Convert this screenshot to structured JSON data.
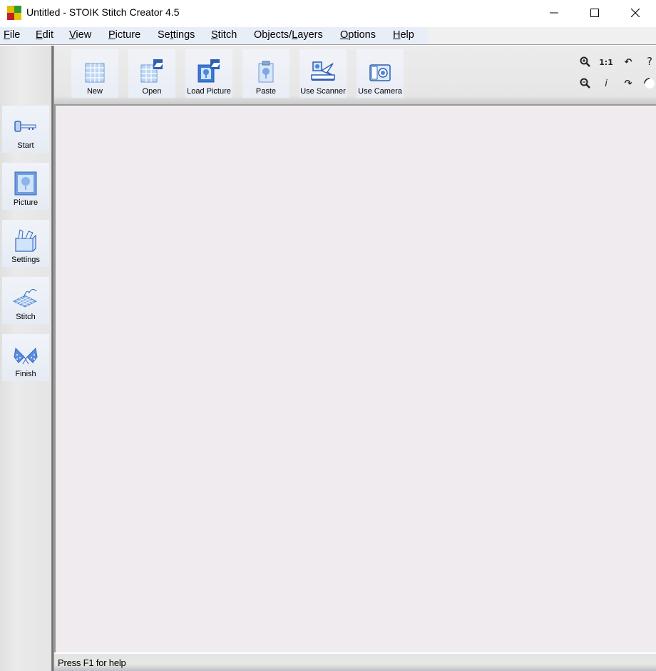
{
  "window": {
    "title": "Untitled - STOIK Stitch Creator 4.5",
    "controls": {
      "minimize": "minimize-icon",
      "maximize": "maximize-icon",
      "close": "close-icon"
    }
  },
  "menubar": {
    "items": [
      {
        "label": "File",
        "mnemonic": "F"
      },
      {
        "label": "Edit",
        "mnemonic": "E"
      },
      {
        "label": "View",
        "mnemonic": "V"
      },
      {
        "label": "Picture",
        "mnemonic": "P"
      },
      {
        "label": "Settings",
        "mnemonic": "t"
      },
      {
        "label": "Stitch",
        "mnemonic": "S"
      },
      {
        "label": "Objects/Layers",
        "mnemonic": "L"
      },
      {
        "label": "Options",
        "mnemonic": "O"
      },
      {
        "label": "Help",
        "mnemonic": "H"
      }
    ]
  },
  "toolbar": {
    "buttons": [
      {
        "label": "New",
        "icon": "new-grid-icon"
      },
      {
        "label": "Open",
        "icon": "open-folder-icon"
      },
      {
        "label": "Load Picture",
        "icon": "load-picture-icon"
      },
      {
        "label": "Paste",
        "icon": "paste-clipboard-icon"
      },
      {
        "label": "Use Scanner",
        "icon": "scanner-icon"
      },
      {
        "label": "Use Camera",
        "icon": "camera-icon"
      }
    ],
    "small_tools": [
      {
        "name": "zoom-in",
        "glyph": "⊕"
      },
      {
        "name": "actual-size",
        "glyph": "1:1"
      },
      {
        "name": "undo",
        "glyph": "↶"
      },
      {
        "name": "help",
        "glyph": "?"
      },
      {
        "name": "zoom-out",
        "glyph": "⊖"
      },
      {
        "name": "info",
        "glyph": "i"
      },
      {
        "name": "redo",
        "glyph": "↷"
      },
      {
        "name": "color",
        "glyph": "●"
      }
    ]
  },
  "sidebar": {
    "steps": [
      {
        "label": "Start",
        "icon": "key-icon"
      },
      {
        "label": "Picture",
        "icon": "picture-frame-icon"
      },
      {
        "label": "Settings",
        "icon": "toolbox-icon"
      },
      {
        "label": "Stitch",
        "icon": "stitch-grid-icon"
      },
      {
        "label": "Finish",
        "icon": "checkered-flags-icon"
      }
    ]
  },
  "statusbar": {
    "text": "Press F1 for help"
  }
}
